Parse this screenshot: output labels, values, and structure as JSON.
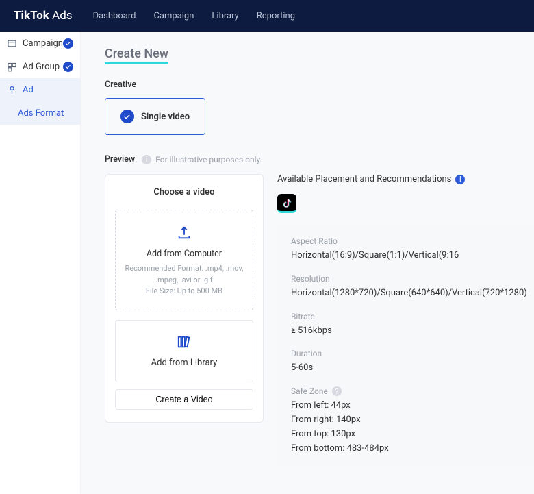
{
  "header": {
    "logo_strong": "TikTok",
    "logo_light": "Ads",
    "nav": [
      "Dashboard",
      "Campaign",
      "Library",
      "Reporting"
    ]
  },
  "sidebar": {
    "items": [
      {
        "label": "Campaign",
        "done": true
      },
      {
        "label": "Ad Group",
        "done": true
      },
      {
        "label": "Ad",
        "done": false
      }
    ],
    "sub": "Ads Format"
  },
  "page": {
    "title": "Create New",
    "creative_label": "Creative",
    "creative_option": "Single video",
    "preview_label": "Preview",
    "preview_note": "For illustrative purposes only."
  },
  "chooser": {
    "title": "Choose a video",
    "from_computer": "Add from Computer",
    "hint1": "Recommended Format: .mp4, .mov,",
    "hint2": ".mpeg, .avi or .gif",
    "hint3": "File Size: Up to 500 MB",
    "from_library": "Add from Library",
    "create": "Create a Video"
  },
  "placement": {
    "title": "Available Placement and Recommendations",
    "specs": {
      "aspect_label": "Aspect Ratio",
      "aspect_value": "Horizontal(16:9)/Square(1:1)/Vertical(9:16",
      "res_label": "Resolution",
      "res_value": "Horizontal(1280*720)/Square(640*640)/Vertical(720*1280)",
      "bitrate_label": "Bitrate",
      "bitrate_value": "≥ 516kbps",
      "duration_label": "Duration",
      "duration_value": "5-60s",
      "safe_label": "Safe Zone",
      "safe_left": "From left: 44px",
      "safe_right": "From right: 140px",
      "safe_top": "From top: 130px",
      "safe_bottom": "From bottom: 483-484px"
    }
  }
}
